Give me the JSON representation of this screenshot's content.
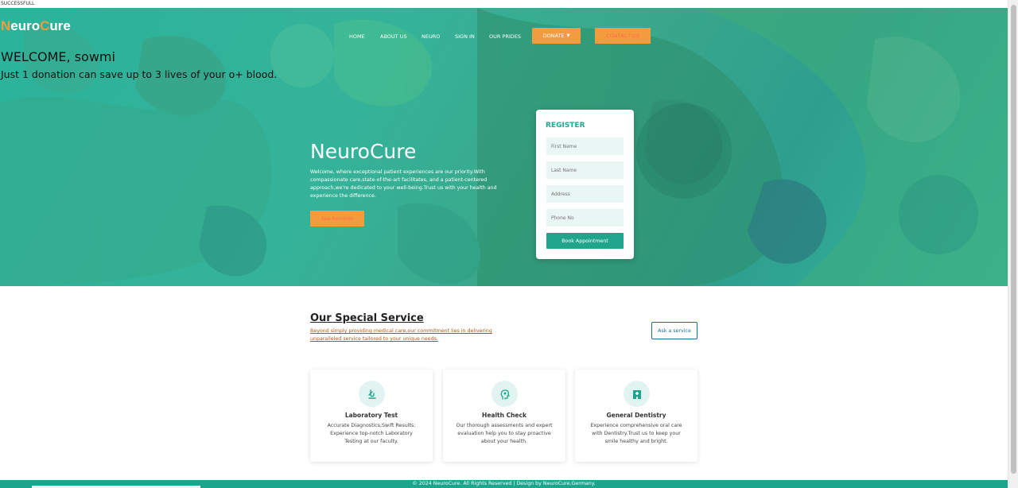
{
  "status_text": "SUCCESSFULL",
  "brand": {
    "part1": "N",
    "part2": "euro",
    "part3": "C",
    "part4": "ure"
  },
  "nav": {
    "home": "HOME",
    "about": "ABOUT US",
    "neuro": "NEURO",
    "signin": "SIGN IN",
    "prides": "OUR PRIDES",
    "donate": "DONATE",
    "contact": "CONTACT US"
  },
  "welcome": "WELCOME, sowmi",
  "tagline": "Just 1 donation can save up to 3 lives of your o+ blood.",
  "hero": {
    "title": "NeuroCure",
    "text": "Welcome, where exceptional patient experiences are our priority.With compassionate care,state-of-the-art facilitates, and a patient-centered approach,we're dedicated to your well-being.Trust us with your health and experience the difference.",
    "button": "See Services"
  },
  "register": {
    "title": "REGISTER",
    "first_name": "First Name",
    "last_name": "Last Name",
    "address": "Address",
    "phone": "Phone No",
    "button": "Book Appointment"
  },
  "services": {
    "title": "Our Special Service",
    "subtitle": "Beyond simply providing medical care,our commitment lies in delivering unparalleled service tailored to your unique needs.",
    "ask_button": "Ask a service",
    "cards": [
      {
        "icon": "lab-test-icon",
        "title": "Laboratory Test",
        "desc": "Accurate Diagnostics,Swift Results: Experience top-notch Laboratory Testing at our faculty."
      },
      {
        "icon": "health-check-icon",
        "title": "Health Check",
        "desc": "Our thorough assessments and expert evaluation help you to stay proactive about your health."
      },
      {
        "icon": "dentistry-icon",
        "title": "General Dentistry",
        "desc": "Experience comprehensive oral care with Dentistry.Trust us to keep your smile healthy and bright."
      }
    ]
  },
  "footer": "© 2024 NeuroCure. All Rights Reserved | Design by NeuroCure,Germany.",
  "colors": {
    "primary": "#1fa58c",
    "accent": "#f39c3d",
    "hero_bg": "#2bb39b"
  }
}
